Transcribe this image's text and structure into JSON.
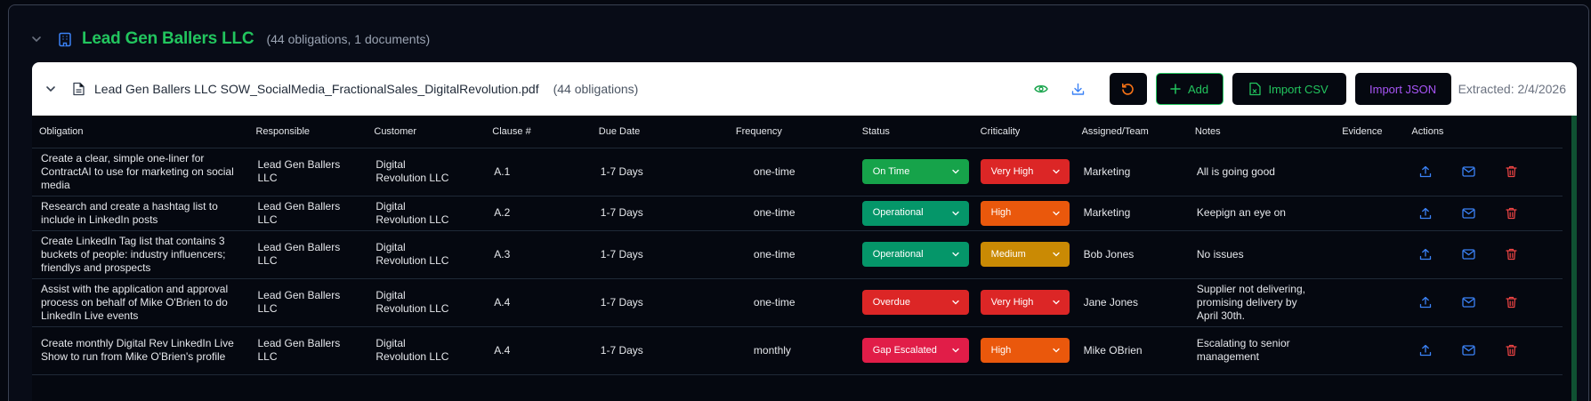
{
  "company": {
    "name": "Lead Gen Ballers LLC",
    "meta": "(44 obligations, 1 documents)"
  },
  "document": {
    "name": "Lead Gen Ballers LLC SOW_SocialMedia_FractionalSales_DigitalRevolution.pdf",
    "count": "(44 obligations)",
    "add_label": "Add",
    "import_csv_label": "Import CSV",
    "import_json_label": "Import JSON",
    "extracted": "Extracted: 2/4/2026"
  },
  "columns": [
    "Obligation",
    "Responsible",
    "Customer",
    "Clause #",
    "Due Date",
    "Frequency",
    "Status",
    "Criticality",
    "Assigned/Team",
    "Notes",
    "Evidence",
    "Actions"
  ],
  "rows": [
    {
      "obligation": "Create a clear, simple one-liner for ContractAI to use for marketing on social media",
      "responsible": "Lead Gen Ballers LLC",
      "customer": "Digital Revolution LLC",
      "clause": "A.1",
      "due": "1-7 Days",
      "frequency": "one-time",
      "status": "On Time",
      "criticality": "Very High",
      "assigned": "Marketing",
      "notes": "All is going good"
    },
    {
      "obligation": "Research and create a hashtag list to include in LinkedIn posts",
      "responsible": "Lead Gen Ballers LLC",
      "customer": "Digital Revolution LLC",
      "clause": "A.2",
      "due": "1-7 Days",
      "frequency": "one-time",
      "status": "Operational",
      "criticality": "High",
      "assigned": "Marketing",
      "notes": "Keepign an eye on"
    },
    {
      "obligation": "Create LinkedIn Tag list that contains 3 buckets of people: industry influencers; friendlys and prospects",
      "responsible": "Lead Gen Ballers LLC",
      "customer": "Digital Revolution LLC",
      "clause": "A.3",
      "due": "1-7 Days",
      "frequency": "one-time",
      "status": "Operational",
      "criticality": "Medium",
      "assigned": "Bob Jones",
      "notes": "No issues"
    },
    {
      "obligation": "Assist with the application and approval process on behalf of Mike O'Brien to do LinkedIn Live events",
      "responsible": "Lead Gen Ballers LLC",
      "customer": "Digital Revolution LLC",
      "clause": "A.4",
      "due": "1-7 Days",
      "frequency": "one-time",
      "status": "Overdue",
      "criticality": "Very High",
      "assigned": "Jane Jones",
      "notes": "Supplier not delivering, promising delivery by April 30th."
    },
    {
      "obligation": "Create monthly Digital Rev LinkedIn Live Show to run from Mike O'Brien's profile",
      "responsible": "Lead Gen Ballers LLC",
      "customer": "Digital Revolution LLC",
      "clause": "A.4",
      "due": "1-7 Days",
      "frequency": "monthly",
      "status": "Gap Escalated",
      "criticality": "High",
      "assigned": "Mike OBrien",
      "notes": "Escalating to senior management"
    }
  ],
  "status_colors": {
    "On Time": "#16a34a",
    "Operational": "#059669",
    "Overdue": "#dc2626",
    "Gap Escalated": "#e11d48"
  },
  "criticality_colors": {
    "Very High": "#dc2626",
    "High": "#ea580c",
    "Medium": "#ca8a04"
  },
  "icons": {
    "collapse": "chevron-down-icon",
    "company": "building-icon",
    "file": "file-text-icon",
    "view": "eye-icon",
    "download": "download-icon",
    "reset": "refresh-icon",
    "add": "plus-icon",
    "csv": "file-spreadsheet-icon",
    "upload": "upload-icon",
    "email": "mail-icon",
    "delete": "trash-icon"
  }
}
